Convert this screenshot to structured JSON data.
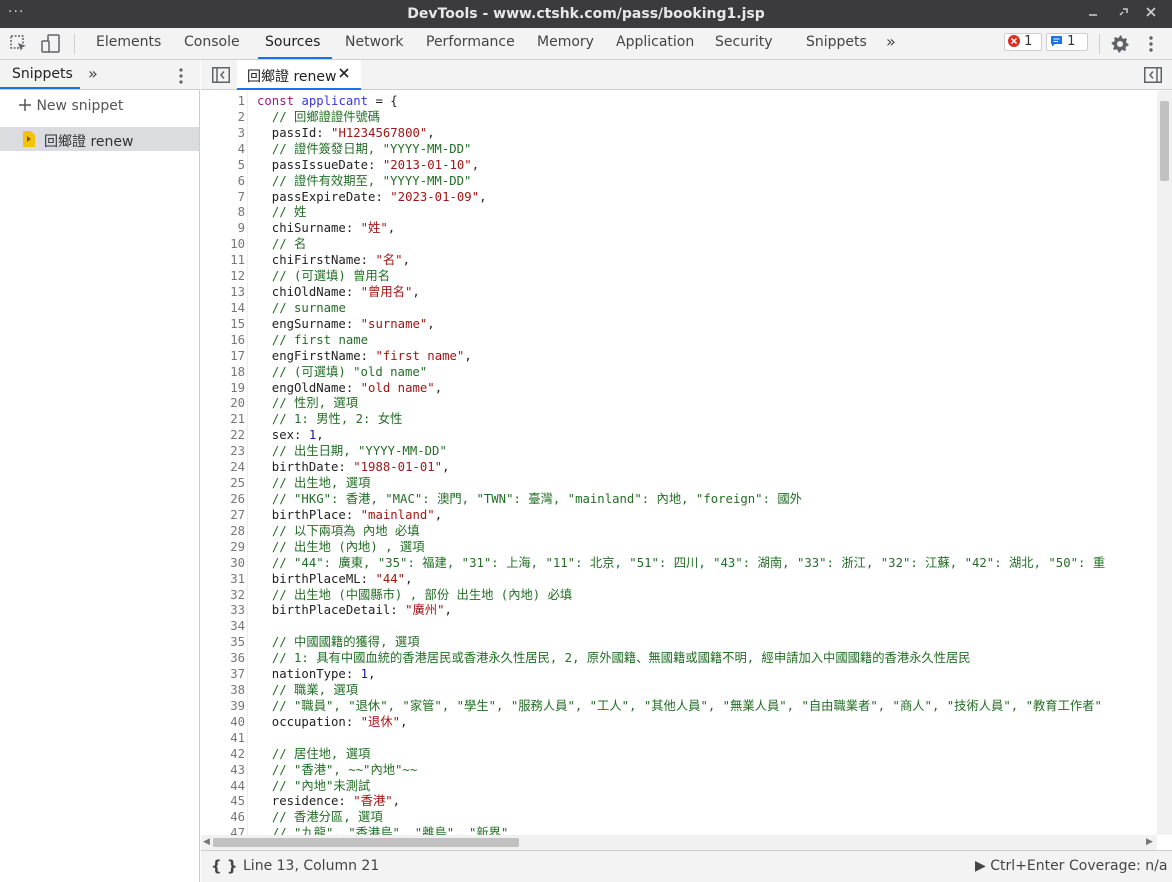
{
  "window": {
    "title": "DevTools - www.ctshk.com/pass/booking1.jsp",
    "menu_glyph": "···"
  },
  "toolbar": {
    "tabs": [
      "Elements",
      "Console",
      "Sources",
      "Network",
      "Performance",
      "Memory",
      "Application",
      "Security",
      "Snippets"
    ],
    "active_tab": "Sources",
    "more_glyph": "»",
    "errors_count": "1",
    "messages_count": "1"
  },
  "navigator": {
    "tab_label": "Snippets",
    "more_glyph": "»",
    "new_snippet_label": "New snippet",
    "snippet_name": "回鄉證 renew"
  },
  "editor": {
    "file_tab": "回鄉證 renew",
    "lines": [
      "const applicant = {",
      "  // 回鄉證證件號碼",
      "  passId: \"H1234567800\",",
      "  // 證件簽發日期, \"YYYY-MM-DD\"",
      "  passIssueDate: \"2013-01-10\",",
      "  // 證件有效期至, \"YYYY-MM-DD\"",
      "  passExpireDate: \"2023-01-09\",",
      "  // 姓",
      "  chiSurname: \"姓\",",
      "  // 名",
      "  chiFirstName: \"名\",",
      "  // (可選填) 曾用名",
      "  chiOldName: \"曾用名\",",
      "  // surname",
      "  engSurname: \"surname\",",
      "  // first name",
      "  engFirstName: \"first name\",",
      "  // (可選填) \"old name\"",
      "  engOldName: \"old name\",",
      "  // 性別, 選項",
      "  // 1: 男性, 2: 女性",
      "  sex: 1,",
      "  // 出生日期, \"YYYY-MM-DD\"",
      "  birthDate: \"1988-01-01\",",
      "  // 出生地, 選項",
      "  // \"HKG\": 香港, \"MAC\": 澳門, \"TWN\": 臺灣, \"mainland\": 內地, \"foreign\": 國外",
      "  birthPlace: \"mainland\",",
      "  // 以下兩項為 內地 必填",
      "  // 出生地 (內地) , 選項",
      "  // \"44\": 廣東, \"35\": 福建, \"31\": 上海, \"11\": 北京, \"51\": 四川, \"43\": 湖南, \"33\": 浙江, \"32\": 江蘇, \"42\": 湖北, \"50\": 重",
      "  birthPlaceML: \"44\",",
      "  // 出生地 (中國縣市) , 部份 出生地 (內地) 必填",
      "  birthPlaceDetail: \"廣州\",",
      "",
      "  // 中國國籍的獲得, 選項",
      "  // 1: 具有中國血統的香港居民或香港永久性居民, 2, 原外國籍、無國籍或國籍不明, 經申請加入中國國籍的香港永久性居民",
      "  nationType: 1,",
      "  // 職業, 選項",
      "  // \"職員\", \"退休\", \"家管\", \"學生\", \"服務人員\", \"工人\", \"其他人員\", \"無業人員\", \"自由職業者\", \"商人\", \"技術人員\", \"教育工作者\"",
      "  occupation: \"退休\",",
      "",
      "  // 居住地, 選項",
      "  // \"香港\", ~~\"內地\"~~",
      "  // \"內地\"未測試",
      "  residence: \"香港\",",
      "  // 香港分區, 選項",
      "  // \"九龍\", \"香港島\", \"離島\", \"新界\""
    ]
  },
  "status": {
    "position": "Line 13, Column 21",
    "braces": "{ }",
    "run": "▶ Ctrl+Enter",
    "coverage": "Coverage: n/a"
  }
}
